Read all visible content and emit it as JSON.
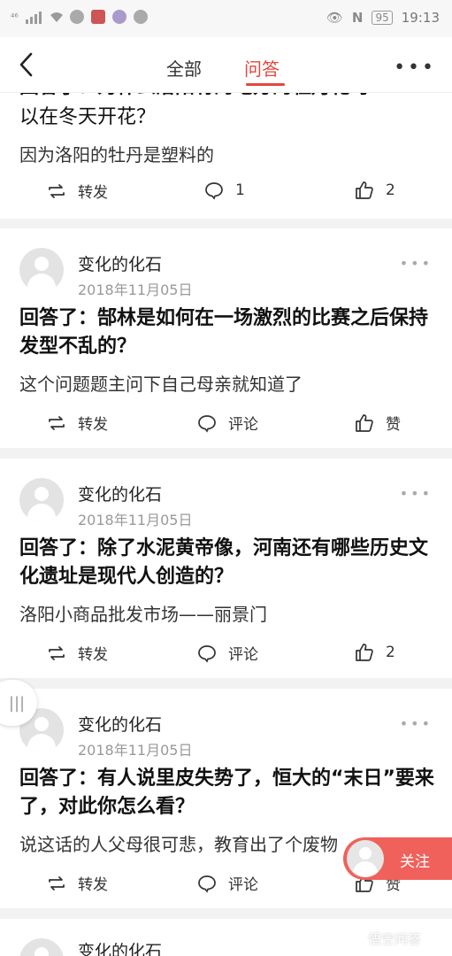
{
  "status_bar": {
    "carrier": "⁴⁶",
    "battery": "95",
    "time": "19:13"
  },
  "nav": {
    "tab_all": "全部",
    "tab_qa": "问答"
  },
  "card1": {
    "title_line1_partial": "回答了：为什么洛阳有的地方的牡丹花可",
    "title_line2": "以在冬天开花？",
    "answer": "因为洛阳的牡丹是塑料的",
    "repost": "转发",
    "comment": "1",
    "like": "2"
  },
  "card2": {
    "user": "变化的化石",
    "date": "2018年11月05日",
    "title": "回答了：郜林是如何在一场激烈的比赛之后保持发型不乱的？",
    "answer": "这个问题题主问下自己母亲就知道了",
    "repost": "转发",
    "comment": "评论",
    "like": "赞"
  },
  "card3": {
    "user": "变化的化石",
    "date": "2018年11月05日",
    "title": "回答了：除了水泥黄帝像，河南还有哪些历史文化遗址是现代人创造的？",
    "answer": "洛阳小商品批发市场——丽景门",
    "repost": "转发",
    "comment": "评论",
    "like": "2"
  },
  "card4": {
    "user": "变化的化石",
    "date": "2018年11月05日",
    "title": "回答了：有人说里皮失势了，恒大的“末日”要来了，对此你怎么看？",
    "answer": "说这话的人父母很可悲，教育出了个废物",
    "repost": "转发",
    "comment": "评论",
    "like": "赞"
  },
  "card5": {
    "user": "变化的化石"
  },
  "follow_label": "关注",
  "watermark": "悟空问答",
  "colors": {
    "accent": "#e2483c",
    "follow_bg": "#f0615b"
  },
  "icons": [
    "back-arrow-icon",
    "more-icon",
    "repost-icon",
    "comment-icon",
    "like-icon",
    "avatar-icon"
  ]
}
